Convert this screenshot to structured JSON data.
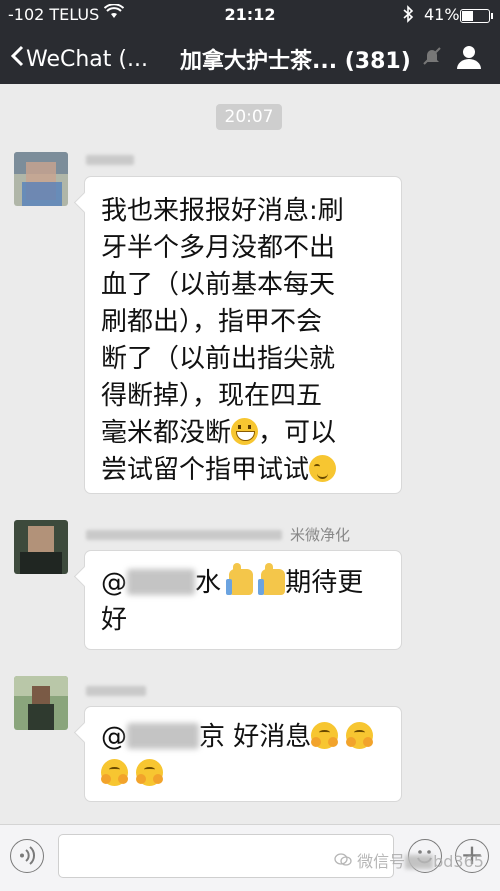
{
  "status_bar": {
    "carrier": "-102 TELUS",
    "time": "21:12",
    "battery_percent": "41%",
    "battery_level": 0.41,
    "icons": [
      "wifi-icon",
      "bluetooth-icon",
      "battery-icon"
    ]
  },
  "nav": {
    "back_label": "WeChat (...",
    "title": "加拿大护士茶... (381)",
    "icons": [
      "chevron-left-icon",
      "mute-icon",
      "contact-icon"
    ]
  },
  "chat": {
    "timestamp": "20:07",
    "messages": [
      {
        "sender_name": "",
        "lines": [
          {
            "text": "我也来报报好消息:刷"
          },
          {
            "text": "牙半个多月没都不出"
          },
          {
            "text": "血了（以前基本每天"
          },
          {
            "text": "刷都出），指甲不会"
          },
          {
            "text": "断了（以前出指尖就"
          },
          {
            "text": "得断掉），现在四五"
          },
          {
            "text": "毫米都没断",
            "suffix": "，可以",
            "emoji": "grinning-emoji"
          },
          {
            "text": "尝试留个指甲试试",
            "emoji": "blush-emoji"
          }
        ]
      },
      {
        "sender_name": "米微净化",
        "prefix": "@",
        "partial": "水",
        "after": "期待更",
        "line2": "好",
        "emojis": [
          "thumbs-up-emoji",
          "thumbs-up-emoji"
        ]
      },
      {
        "sender_name": "",
        "prefix": "@",
        "partial": "京",
        "after": "好消息",
        "emojis": [
          "hug-emoji",
          "hug-emoji",
          "hug-emoji",
          "hug-emoji"
        ]
      }
    ]
  },
  "input_bar": {
    "placeholder": "",
    "icons": [
      "voice-icon",
      "emoji-icon",
      "plus-icon"
    ]
  },
  "watermark": {
    "text": "微信号",
    "suffix": "bd365"
  }
}
